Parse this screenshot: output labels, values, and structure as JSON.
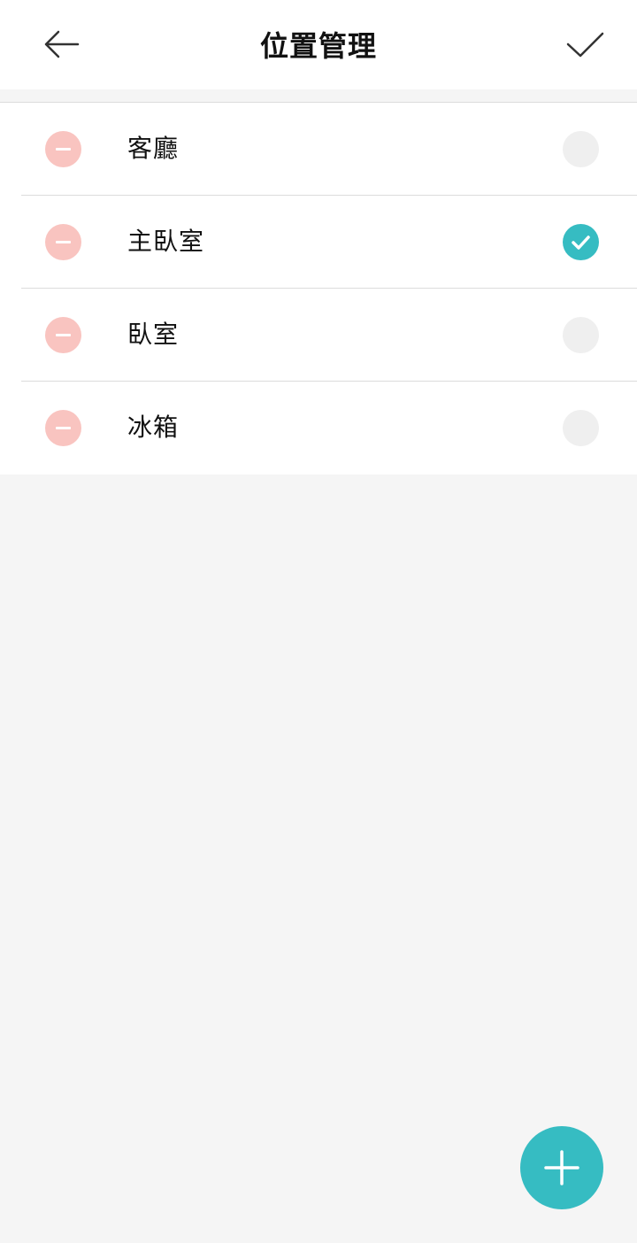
{
  "header": {
    "title": "位置管理",
    "back_icon": "arrow-left-icon",
    "confirm_icon": "checkmark-icon"
  },
  "locations": [
    {
      "name": "客廳",
      "selected": false
    },
    {
      "name": "主臥室",
      "selected": true
    },
    {
      "name": "臥室",
      "selected": false
    },
    {
      "name": "冰箱",
      "selected": false
    }
  ],
  "fab": {
    "icon": "plus-icon"
  },
  "colors": {
    "accent": "#36bcc2",
    "remove": "#f9c4c0",
    "unselected": "#efefef",
    "background": "#f5f5f5"
  }
}
